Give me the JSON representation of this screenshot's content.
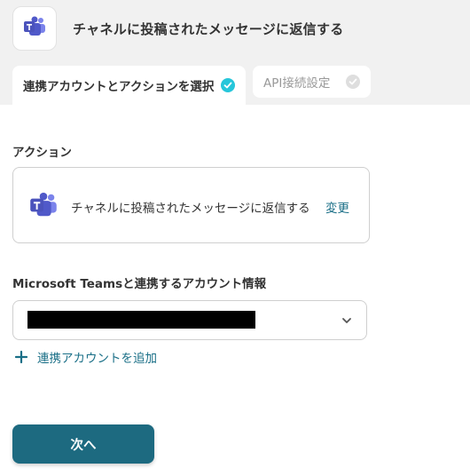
{
  "header": {
    "title": "チャネルに投稿されたメッセージに返信する",
    "app_icon": "microsoft-teams-icon"
  },
  "tabs": [
    {
      "label": "連携アカウントとアクションを選択",
      "state": "active",
      "completed": true
    },
    {
      "label": "API接続設定",
      "state": "inactive",
      "completed": false
    }
  ],
  "action_section": {
    "label": "アクション",
    "card": {
      "text": "チャネルに投稿されたメッセージに返信する",
      "change_label": "変更",
      "icon": "microsoft-teams-icon"
    }
  },
  "account_section": {
    "label": "Microsoft Teamsと連携するアカウント情報",
    "selected_value": "",
    "add_label": "連携アカウントを追加"
  },
  "footer": {
    "next_label": "次へ"
  },
  "colors": {
    "accent": "#1d6a80",
    "link": "#1a6f87",
    "check_active": "#26c6da",
    "teams_purple": "#5059c9"
  }
}
